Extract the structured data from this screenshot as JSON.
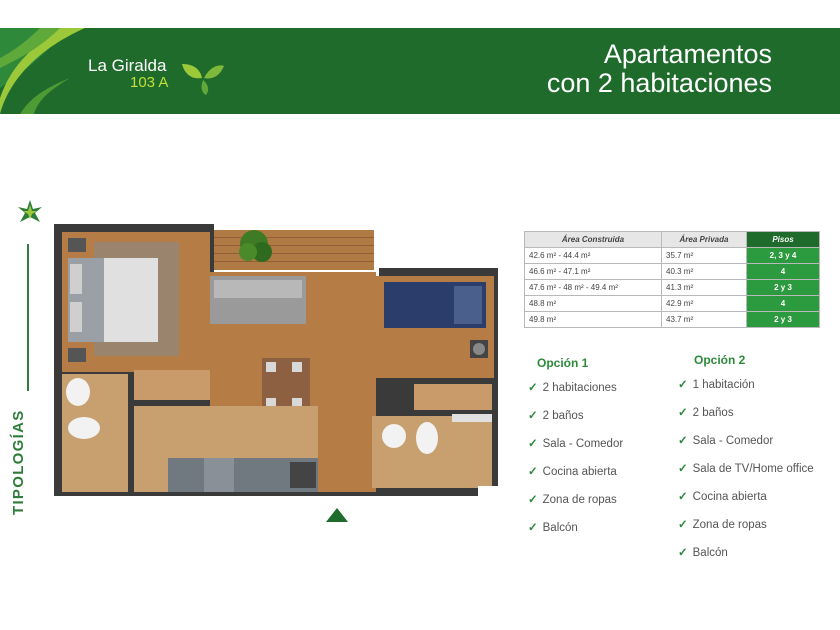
{
  "header": {
    "brand_line1": "La Giralda",
    "brand_line2": "103 A",
    "title_line1": "Apartamentos",
    "title_line2": "con 2 habitaciones"
  },
  "side": {
    "label": "TIPOLOGÍAS"
  },
  "areas_table": {
    "headers": [
      "Área Construida",
      "Área Privada",
      "Pisos"
    ],
    "rows": [
      [
        "42.6 m² - 44.4 m²",
        "35.7 m²",
        "2, 3 y 4"
      ],
      [
        "46.6 m² - 47.1 m²",
        "40.3 m²",
        "4"
      ],
      [
        "47.6 m² - 48 m² - 49.4 m²",
        "41.3 m²",
        "2 y 3"
      ],
      [
        "48.8 m²",
        "42.9 m²",
        "4"
      ],
      [
        "49.8 m²",
        "43.7 m²",
        "2 y 3"
      ]
    ]
  },
  "option1": {
    "title": "Opción 1",
    "items": [
      "2 habitaciones",
      "2 baños",
      "Sala - Comedor",
      "Cocina abierta",
      "Zona de ropas",
      "Balcón"
    ]
  },
  "option2": {
    "title": "Opción 2",
    "items": [
      "1 habitación",
      "2 baños",
      "Sala - Comedor",
      "Sala de TV/Home office",
      "Cocina abierta",
      "Zona de ropas",
      "Balcón"
    ]
  },
  "check_symbol": "✓",
  "colors": {
    "brand_green": "#1e6b2c",
    "accent_green": "#2c9a3f",
    "lime": "#c4de3a"
  }
}
